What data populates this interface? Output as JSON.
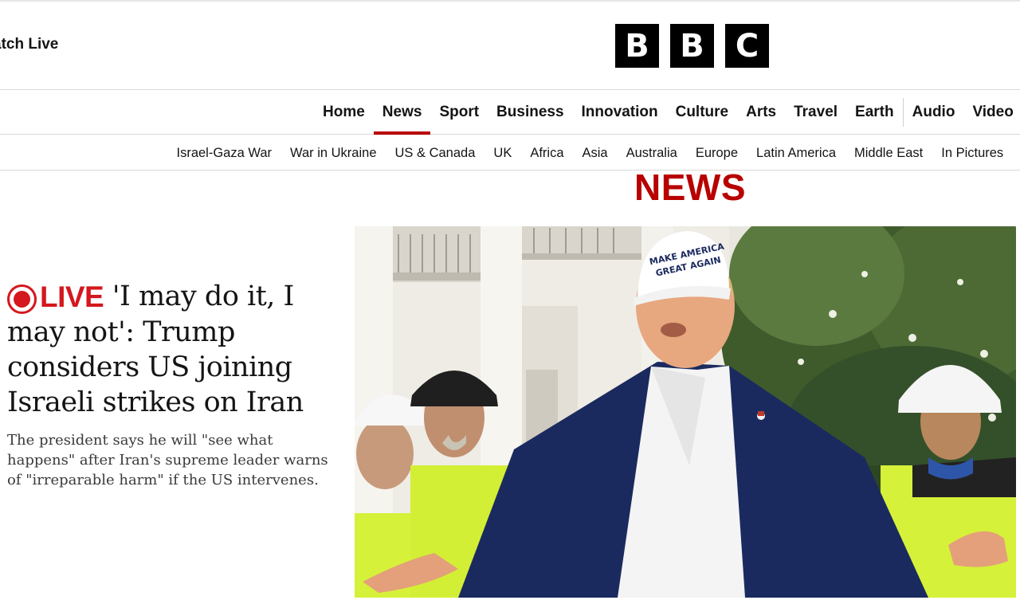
{
  "masthead": {
    "watch_live": "atch Live",
    "logo_letters": [
      "B",
      "B",
      "C"
    ]
  },
  "primary_nav": {
    "items": [
      "Home",
      "News",
      "Sport",
      "Business",
      "Innovation",
      "Culture",
      "Arts",
      "Travel",
      "Earth",
      "Audio",
      "Video"
    ],
    "active": "News"
  },
  "secondary_nav": {
    "items": [
      "Israel-Gaza War",
      "War in Ukraine",
      "US & Canada",
      "UK",
      "Africa",
      "Asia",
      "Australia",
      "Europe",
      "Latin America",
      "Middle East",
      "In Pictures"
    ]
  },
  "section_title": "NEWS",
  "lead_story": {
    "live_label": "LIVE",
    "headline": "'I may do it, I may not': Trump considers US joining Israeli strikes on Iran",
    "summary": "The president says he will \"see what happens\" after Iran's supreme leader warns of \"irreparable harm\" if the US intervenes.",
    "image": {
      "cap_text_line1": "MAKE AMERICA",
      "cap_text_line2": "GREAT AGAIN"
    }
  },
  "colors": {
    "brand_red": "#b80000",
    "live_red": "#d4181e",
    "logo_black": "#000000"
  }
}
